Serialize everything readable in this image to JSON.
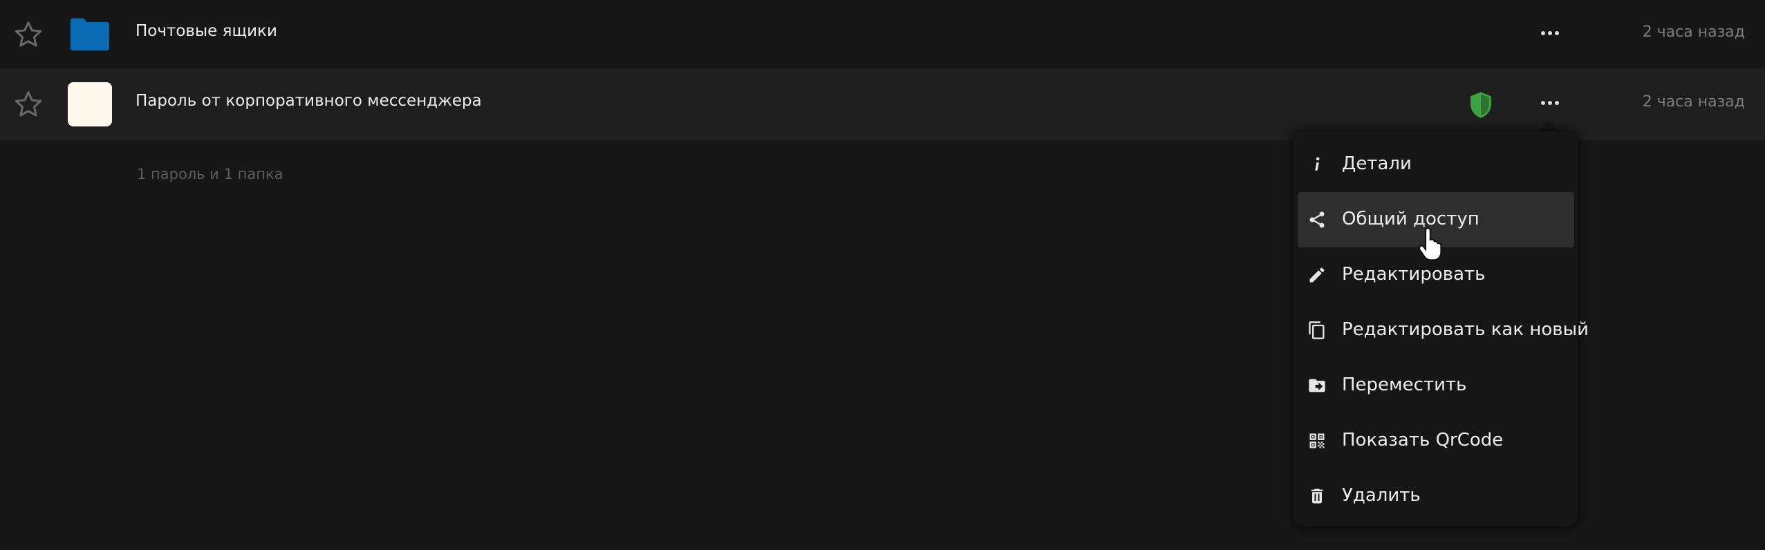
{
  "rows": [
    {
      "title": "Почтовые ящики",
      "time": "2 часа назад",
      "type": "folder",
      "icon": "folder-icon"
    },
    {
      "title": "Пароль от корпоративного мессенджера",
      "time": "2 часа назад",
      "type": "password",
      "security": "secure",
      "icon": "favicon"
    }
  ],
  "footer": {
    "count": "1 пароль и 1 папка"
  },
  "menu": {
    "items": [
      {
        "label": "Детали",
        "icon": "info-icon"
      },
      {
        "label": "Общий доступ",
        "icon": "share-icon",
        "hovered": true
      },
      {
        "label": "Редактировать",
        "icon": "pencil-icon"
      },
      {
        "label": "Редактировать как новый",
        "icon": "copy-icon"
      },
      {
        "label": "Переместить",
        "icon": "folder-move-icon"
      },
      {
        "label": "Показать QrCode",
        "icon": "qrcode-icon"
      },
      {
        "label": "Удалить",
        "icon": "trash-icon"
      }
    ]
  },
  "colors": {
    "background": "#171717",
    "folder": "#0a6bb5",
    "shield_secure": "#3aa33f",
    "menu_hover": "#2e2e2e"
  }
}
